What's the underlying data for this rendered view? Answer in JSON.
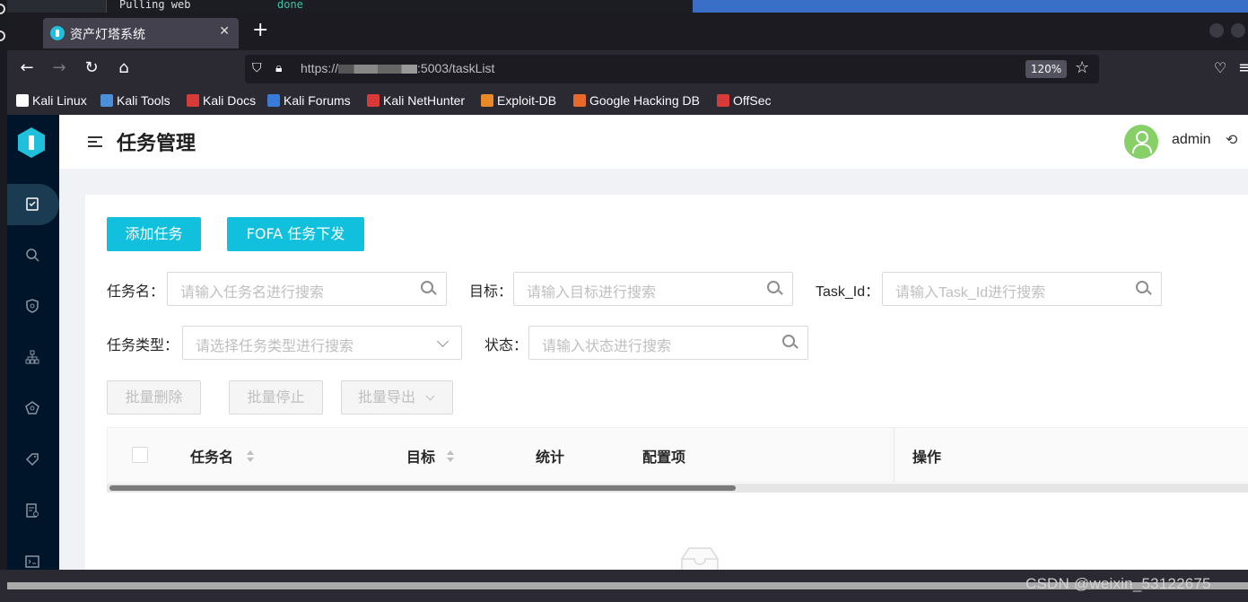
{
  "background_terminal": {
    "cmd": "Pulling web",
    "status": "done"
  },
  "browser": {
    "tab_title": "资产灯塔系统",
    "url_prefix": "https://",
    "url_suffix": ":5003/taskList",
    "zoom": "120%",
    "bookmarks": [
      {
        "label": "Kali Linux",
        "color": "#ffffff"
      },
      {
        "label": "Kali Tools",
        "color": "#4a8fd8"
      },
      {
        "label": "Kali Docs",
        "color": "#d83a3a"
      },
      {
        "label": "Kali Forums",
        "color": "#3a7ad8"
      },
      {
        "label": "Kali NetHunter",
        "color": "#d83a3a"
      },
      {
        "label": "Exploit-DB",
        "color": "#e88a2a"
      },
      {
        "label": "Google Hacking DB",
        "color": "#e86a2a"
      },
      {
        "label": "OffSec",
        "color": "#d83a3a"
      }
    ]
  },
  "header": {
    "page_title": "任务管理",
    "username": "admin"
  },
  "toolbar": {
    "add_task": "添加任务",
    "fofa_task": "FOFA 任务下发"
  },
  "filters": {
    "task_name_label": "任务名：",
    "task_name_placeholder": "请输入任务名进行搜索",
    "target_label": "目标：",
    "target_placeholder": "请输入目标进行搜索",
    "task_id_label": "Task_Id：",
    "task_id_placeholder": "请输入Task_Id进行搜索",
    "task_type_label": "任务类型：",
    "task_type_placeholder": "请选择任务类型进行搜索",
    "status_label": "状态：",
    "status_placeholder": "请输入状态进行搜索"
  },
  "batch": {
    "delete": "批量删除",
    "stop": "批量停止",
    "export": "批量导出"
  },
  "table": {
    "columns": [
      "任务名",
      "目标",
      "统计",
      "配置项",
      "操作"
    ]
  },
  "watermark": "CSDN @weixin_53122675",
  "colors": {
    "accent": "#11c0dc",
    "sider": "#001529",
    "avatar": "#87d068"
  }
}
